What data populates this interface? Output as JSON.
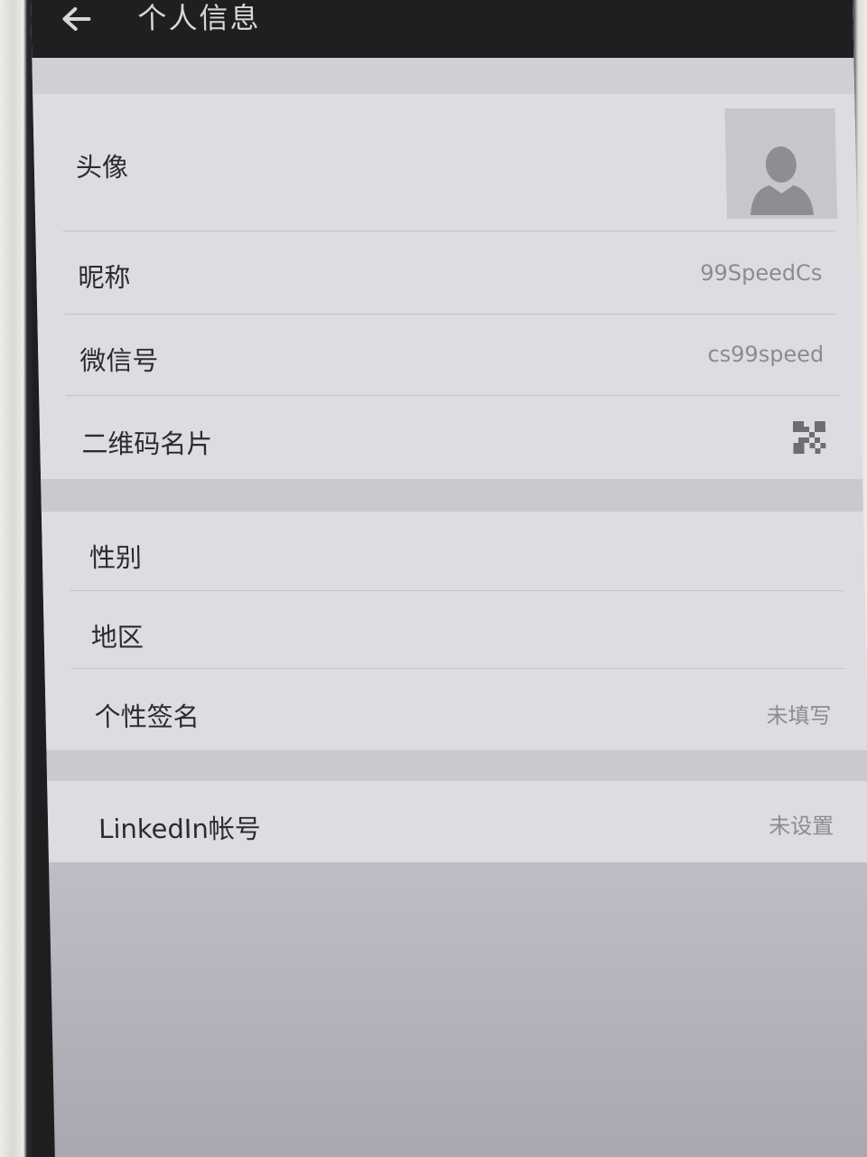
{
  "header": {
    "title": "个人信息",
    "back_icon": "arrow-left-icon"
  },
  "profile_section": [
    {
      "id": "avatar",
      "label": "头像",
      "value": "",
      "icon": "user-silhouette-icon"
    },
    {
      "id": "nickname",
      "label": "昵称",
      "value": "99SpeedCs"
    },
    {
      "id": "wechat_id",
      "label": "微信号",
      "value": "cs99speed"
    },
    {
      "id": "qr_card",
      "label": "二维码名片",
      "value": "",
      "icon": "qr-code-icon"
    }
  ],
  "detail_section": [
    {
      "id": "gender",
      "label": "性别",
      "value": ""
    },
    {
      "id": "region",
      "label": "地区",
      "value": ""
    },
    {
      "id": "signature",
      "label": "个性签名",
      "value": "未填写"
    }
  ],
  "linked_section": [
    {
      "id": "linkedin",
      "label": "LinkedIn帐号",
      "value": "未设置"
    }
  ],
  "colors": {
    "titlebar": "#1f1f21",
    "row_bg": "#dcdce3",
    "separator": "#c9c9d0",
    "label_text": "#2c2c30",
    "value_text": "#8b8b92"
  }
}
